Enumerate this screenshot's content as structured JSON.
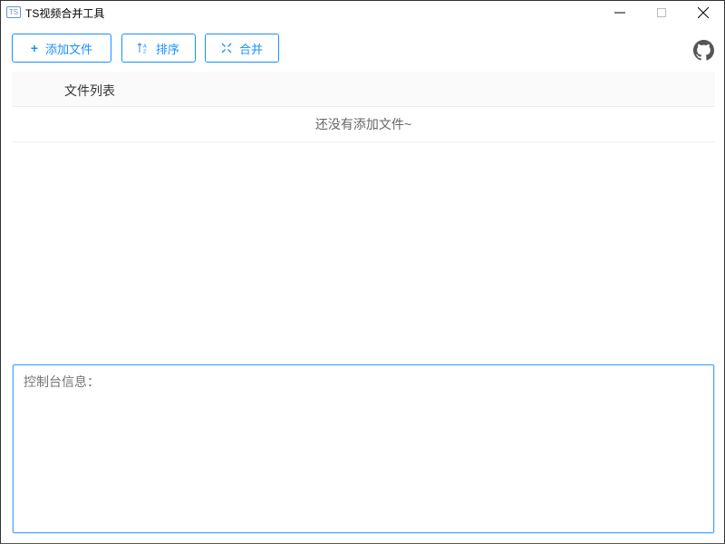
{
  "window": {
    "title": "TS视频合并工具",
    "icon_text": "TS"
  },
  "toolbar": {
    "add_label": "添加文件",
    "sort_label": "排序",
    "merge_label": "合并"
  },
  "table": {
    "header": "文件列表",
    "empty_text": "还没有添加文件~"
  },
  "console": {
    "placeholder": "控制台信息："
  },
  "colors": {
    "accent": "#1890ff"
  }
}
